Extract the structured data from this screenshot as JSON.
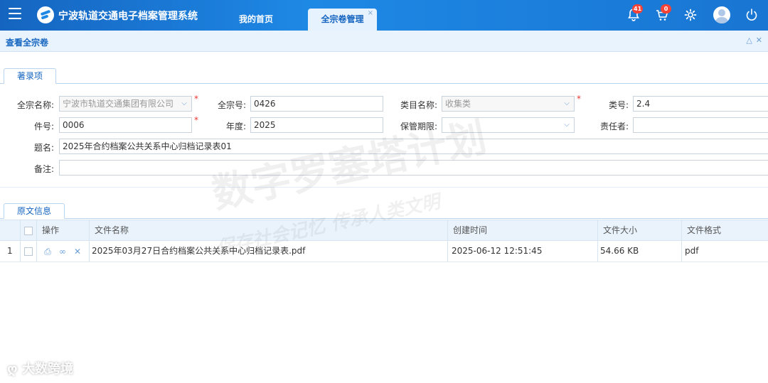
{
  "header": {
    "app_title": "宁波轨道交通电子档案管理系统",
    "nav_home": "我的首页",
    "nav_active": "全宗卷管理",
    "notify_count": "41",
    "cart_count": "0"
  },
  "panel": {
    "title": "查看全宗卷"
  },
  "sections": {
    "record": "著录项",
    "original": "原文信息"
  },
  "form": {
    "fonds_name": {
      "label": "全宗名称:",
      "value": "宁波市轨道交通集团有限公司"
    },
    "fonds_no": {
      "label": "全宗号:",
      "value": "0426"
    },
    "category_name": {
      "label": "类目名称:",
      "value": "收集类"
    },
    "category_no": {
      "label": "类号:",
      "value": "2.4"
    },
    "item_no": {
      "label": "件号:",
      "value": "0006"
    },
    "year": {
      "label": "年度:",
      "value": "2025"
    },
    "retention": {
      "label": "保管期限:",
      "value": ""
    },
    "responsible": {
      "label": "责任者:",
      "value": ""
    },
    "title": {
      "label": "题名:",
      "value": "2025年合约档案公共关系中心归档记录表01"
    },
    "remark": {
      "label": "备注:",
      "value": ""
    }
  },
  "table": {
    "headers": {
      "op": "操作",
      "filename": "文件名称",
      "created": "创建时间",
      "size": "文件大小",
      "format": "文件格式"
    },
    "rows": [
      {
        "index": "1",
        "filename": "2025年03月27日合约档案公共关系中心归档记录表.pdf",
        "created": "2025-06-12 12:51:45",
        "size": "54.66 KB",
        "format": "pdf"
      }
    ]
  },
  "watermark": {
    "main": "数字罗塞塔计划",
    "sub": "保存社会记忆 传承人类文明",
    "footer": "大数跨境"
  }
}
